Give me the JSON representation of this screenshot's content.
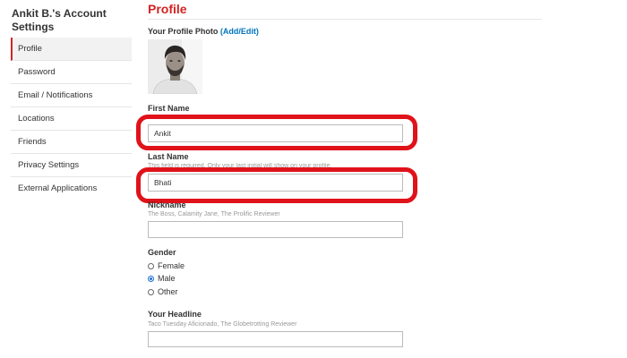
{
  "sidebar": {
    "title": "Ankit B.'s Account Settings",
    "items": [
      {
        "label": "Profile",
        "active": true
      },
      {
        "label": "Password",
        "active": false
      },
      {
        "label": "Email / Notifications",
        "active": false
      },
      {
        "label": "Locations",
        "active": false
      },
      {
        "label": "Friends",
        "active": false
      },
      {
        "label": "Privacy Settings",
        "active": false
      },
      {
        "label": "External Applications",
        "active": false
      }
    ]
  },
  "main": {
    "heading": "Profile",
    "photo": {
      "label": "Your Profile Photo",
      "link": "(Add/Edit)"
    },
    "first_name": {
      "label": "First Name",
      "value": "Ankit"
    },
    "last_name": {
      "label": "Last Name",
      "hint": "This field is required. Only your last initial will show on your profile.",
      "value": "Bhati"
    },
    "nickname": {
      "label": "Nickname",
      "hint": "The Boss, Calamity Jane, The Prolific Reviewer",
      "value": ""
    },
    "gender": {
      "label": "Gender",
      "options": [
        "Female",
        "Male",
        "Other"
      ],
      "selected": "Male"
    },
    "headline": {
      "label": "Your Headline",
      "hint": "Taco Tuesday Aficionado, The Globetrotting Reviewer",
      "value": ""
    }
  },
  "colors": {
    "brand_red": "#d32323",
    "link_blue": "#0073bb",
    "annotation_red": "#e0121a"
  }
}
